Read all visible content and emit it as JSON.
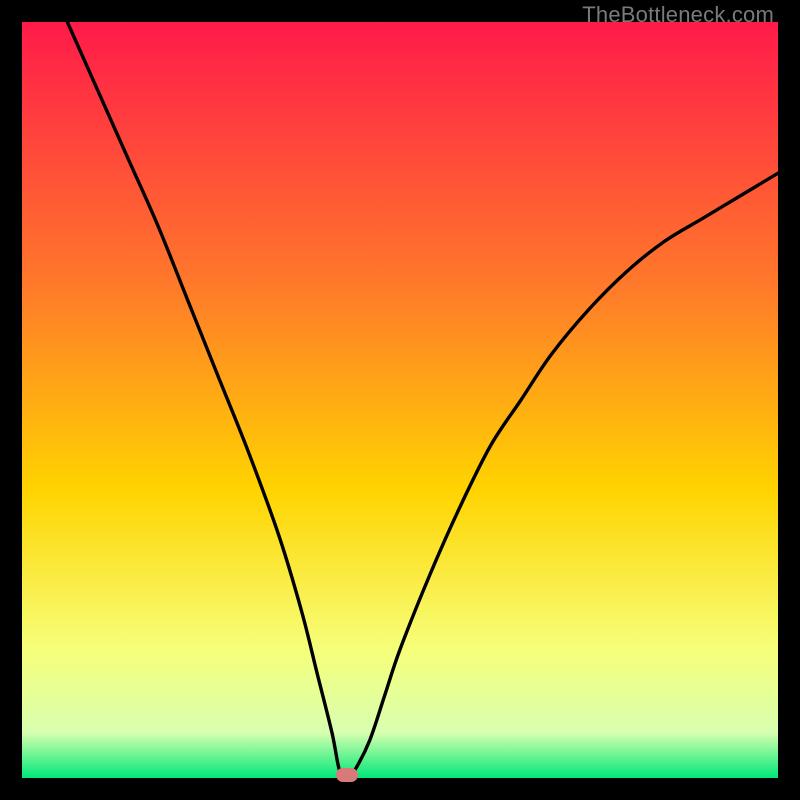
{
  "watermark": "TheBottleneck.com",
  "colors": {
    "frame": "#000000",
    "curve": "#000000",
    "dot": "#d97a7a",
    "gradient_top": "#ff1a4a",
    "gradient_mid_upper": "#ff7a2a",
    "gradient_mid": "#ffd400",
    "gradient_mid_lower": "#f6ff7a",
    "gradient_near_bottom": "#d8ffb0",
    "gradient_bottom": "#00e878"
  },
  "chart_data": {
    "type": "line",
    "title": "",
    "xlabel": "",
    "ylabel": "",
    "xlim": [
      0,
      100
    ],
    "ylim": [
      0,
      100
    ],
    "series": [
      {
        "name": "bottleneck-curve",
        "x": [
          6,
          10,
          14,
          18,
          22,
          26,
          30,
          34,
          37,
          39,
          41,
          42,
          43,
          44,
          46,
          48,
          50,
          54,
          58,
          62,
          66,
          70,
          75,
          80,
          85,
          90,
          95,
          100
        ],
        "y": [
          100,
          91,
          82,
          73,
          63,
          53,
          43,
          32,
          22,
          14,
          6,
          1,
          0,
          1,
          5,
          11,
          17,
          27,
          36,
          44,
          50,
          56,
          62,
          67,
          71,
          74,
          77,
          80
        ]
      }
    ],
    "annotations": [
      {
        "name": "optimal-point",
        "x": 43,
        "y": 0
      }
    ]
  }
}
